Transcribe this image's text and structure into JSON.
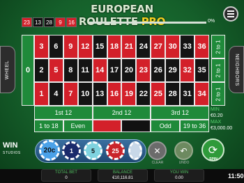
{
  "title": {
    "main": "EUROPEAN ROULETTE",
    "pro": "PRO"
  },
  "history": [
    {
      "n": "23",
      "c": "red"
    },
    {
      "n": "13",
      "c": "black"
    },
    {
      "n": "28",
      "c": "black"
    },
    {
      "n": "9",
      "c": "red"
    },
    {
      "n": "16",
      "c": "red"
    }
  ],
  "progress": {
    "value": "0%",
    "fraction": 0
  },
  "side_tabs": {
    "left": "WHEEL",
    "right": "NEIGHBORS"
  },
  "board": {
    "zero": "0",
    "rows": [
      [
        {
          "n": "3",
          "c": "r"
        },
        {
          "n": "6",
          "c": "b"
        },
        {
          "n": "9",
          "c": "r"
        },
        {
          "n": "12",
          "c": "r"
        },
        {
          "n": "15",
          "c": "b"
        },
        {
          "n": "18",
          "c": "r"
        },
        {
          "n": "21",
          "c": "r"
        },
        {
          "n": "24",
          "c": "b"
        },
        {
          "n": "27",
          "c": "r"
        },
        {
          "n": "30",
          "c": "r"
        },
        {
          "n": "33",
          "c": "b"
        },
        {
          "n": "36",
          "c": "r"
        }
      ],
      [
        {
          "n": "2",
          "c": "b"
        },
        {
          "n": "5",
          "c": "r"
        },
        {
          "n": "8",
          "c": "b"
        },
        {
          "n": "11",
          "c": "b"
        },
        {
          "n": "14",
          "c": "r"
        },
        {
          "n": "17",
          "c": "b"
        },
        {
          "n": "20",
          "c": "b"
        },
        {
          "n": "23",
          "c": "r"
        },
        {
          "n": "26",
          "c": "b"
        },
        {
          "n": "29",
          "c": "b"
        },
        {
          "n": "32",
          "c": "r"
        },
        {
          "n": "35",
          "c": "b"
        }
      ],
      [
        {
          "n": "1",
          "c": "r"
        },
        {
          "n": "4",
          "c": "b"
        },
        {
          "n": "7",
          "c": "r"
        },
        {
          "n": "10",
          "c": "b"
        },
        {
          "n": "13",
          "c": "b"
        },
        {
          "n": "16",
          "c": "r"
        },
        {
          "n": "19",
          "c": "r"
        },
        {
          "n": "22",
          "c": "b"
        },
        {
          "n": "25",
          "c": "r"
        },
        {
          "n": "28",
          "c": "b"
        },
        {
          "n": "31",
          "c": "b"
        },
        {
          "n": "34",
          "c": "r"
        }
      ]
    ],
    "columns": [
      "2 to 1",
      "2 to 1",
      "2 to 1"
    ],
    "dozens": [
      "1st 12",
      "2nd 12",
      "3rd 12"
    ],
    "evens": [
      "1 to 18",
      "Even",
      "",
      "",
      "Odd",
      "19 to 36"
    ]
  },
  "bet_info": {
    "min_label": "MIN",
    "min_value": "€0.20",
    "max_label": "MAX",
    "max_value": "€3,000.00"
  },
  "chips": [
    "20c",
    "1",
    "5",
    "25",
    ""
  ],
  "buttons": {
    "clear": "CLEAR",
    "undo": "UNDO",
    "spin": "SPIN"
  },
  "logo": {
    "main": "WIN",
    "sub": "STUDIOS"
  },
  "stats": {
    "total_bet_label": "TOTAL BET",
    "total_bet_value": "0",
    "balance_label": "BALANCE",
    "balance_value": "€10,116.81",
    "win_label": "YOU WIN",
    "win_value": "0.00"
  },
  "clock": "11:50"
}
